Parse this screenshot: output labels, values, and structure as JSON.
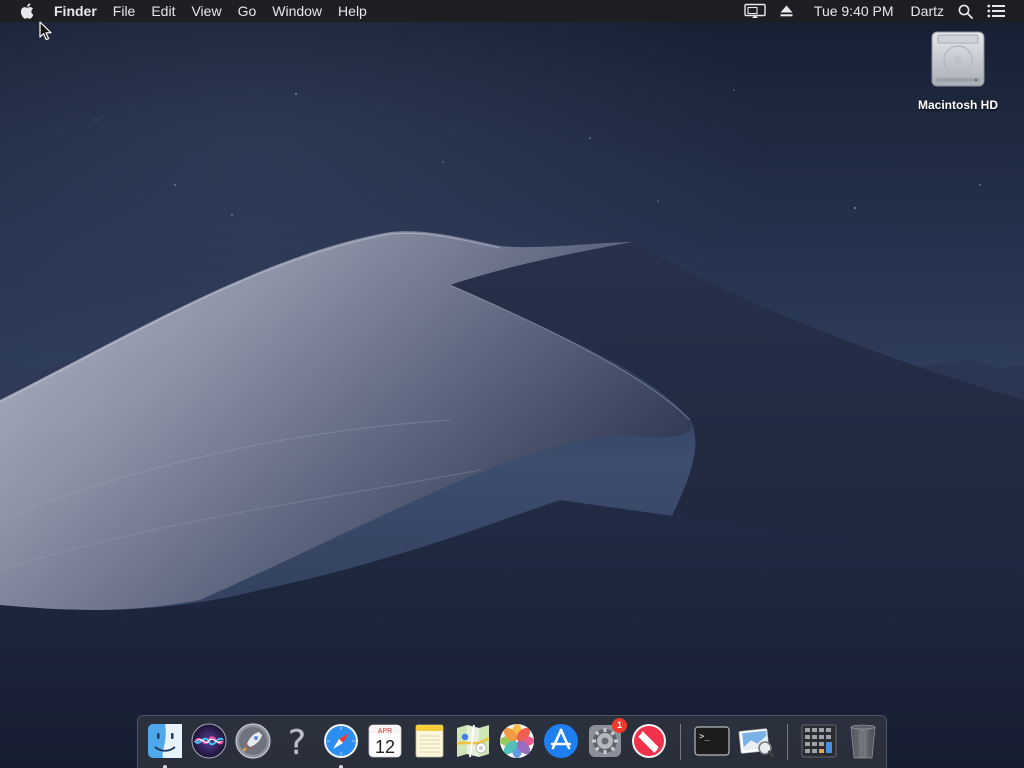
{
  "menubar": {
    "apple_icon": "apple-logo-icon",
    "app_name": "Finder",
    "items": [
      {
        "label": "File"
      },
      {
        "label": "Edit"
      },
      {
        "label": "View"
      },
      {
        "label": "Go"
      },
      {
        "label": "Window"
      },
      {
        "label": "Help"
      }
    ],
    "status": {
      "display_icon": "airplay-display-icon",
      "eject_icon": "eject-icon",
      "clock": "Tue 9:40 PM",
      "user": "Dartz",
      "search_icon": "spotlight-search-icon",
      "notification_icon": "notification-center-icon"
    }
  },
  "desktop": {
    "icons": [
      {
        "label": "Macintosh HD",
        "icon": "hard-drive-icon"
      }
    ]
  },
  "dock": {
    "apps": [
      {
        "name": "Finder",
        "icon": "finder-icon",
        "running": true
      },
      {
        "name": "Siri",
        "icon": "siri-icon",
        "running": false
      },
      {
        "name": "Launchpad",
        "icon": "launchpad-rocket-icon",
        "running": false
      },
      {
        "name": "Help",
        "icon": "question-mark-icon",
        "running": false
      },
      {
        "name": "Safari",
        "icon": "safari-compass-icon",
        "running": true
      },
      {
        "name": "Calendar",
        "icon": "calendar-icon",
        "running": false,
        "month": "APR",
        "day": "12"
      },
      {
        "name": "Notes",
        "icon": "notes-icon",
        "running": false
      },
      {
        "name": "Maps",
        "icon": "maps-icon",
        "running": false
      },
      {
        "name": "Photos",
        "icon": "photos-icon",
        "running": false
      },
      {
        "name": "App Store",
        "icon": "app-store-icon",
        "running": false
      },
      {
        "name": "System Preferences",
        "icon": "system-preferences-gear-icon",
        "running": false,
        "badge": "1"
      },
      {
        "name": "News",
        "icon": "news-icon",
        "running": false
      },
      {
        "name": "Terminal",
        "icon": "terminal-icon",
        "running": false,
        "prompt": ">_"
      },
      {
        "name": "Preview",
        "icon": "preview-icon",
        "running": false
      },
      {
        "name": "Downloads",
        "icon": "downloads-stack-icon",
        "running": false
      },
      {
        "name": "Trash",
        "icon": "trash-icon",
        "running": false
      }
    ]
  },
  "colors": {
    "sky_top": "#1b2438",
    "sky_bottom": "#3a4a6a",
    "dune_light": "#8a93a8",
    "dune_shadow": "#1a2238",
    "menubar_bg": "#1e1e22",
    "badge": "#f0392c"
  }
}
